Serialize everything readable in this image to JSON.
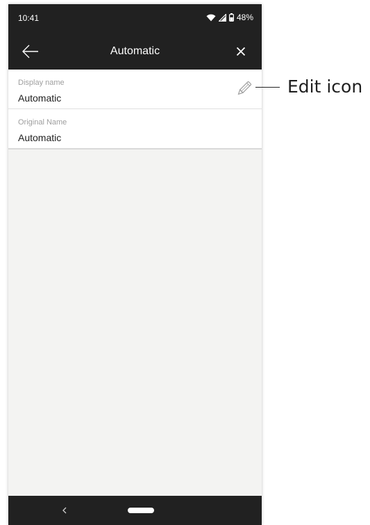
{
  "status_bar": {
    "time": "10:41",
    "battery": "48%"
  },
  "app_bar": {
    "title": "Automatic"
  },
  "fields": [
    {
      "label": "Display name",
      "value": "Automatic",
      "editable": true
    },
    {
      "label": "Original Name",
      "value": "Automatic",
      "editable": false
    }
  ],
  "icons": {
    "back": "arrow-left-icon",
    "close": "close-icon",
    "edit": "pencil-icon",
    "wifi": "wifi-icon",
    "signal": "cell-signal-icon",
    "battery": "battery-icon"
  },
  "annotation": {
    "label": "Edit icon"
  },
  "colors": {
    "bar": "#212121",
    "content_bg": "#f3f3f2",
    "label": "#9e9e9e"
  }
}
